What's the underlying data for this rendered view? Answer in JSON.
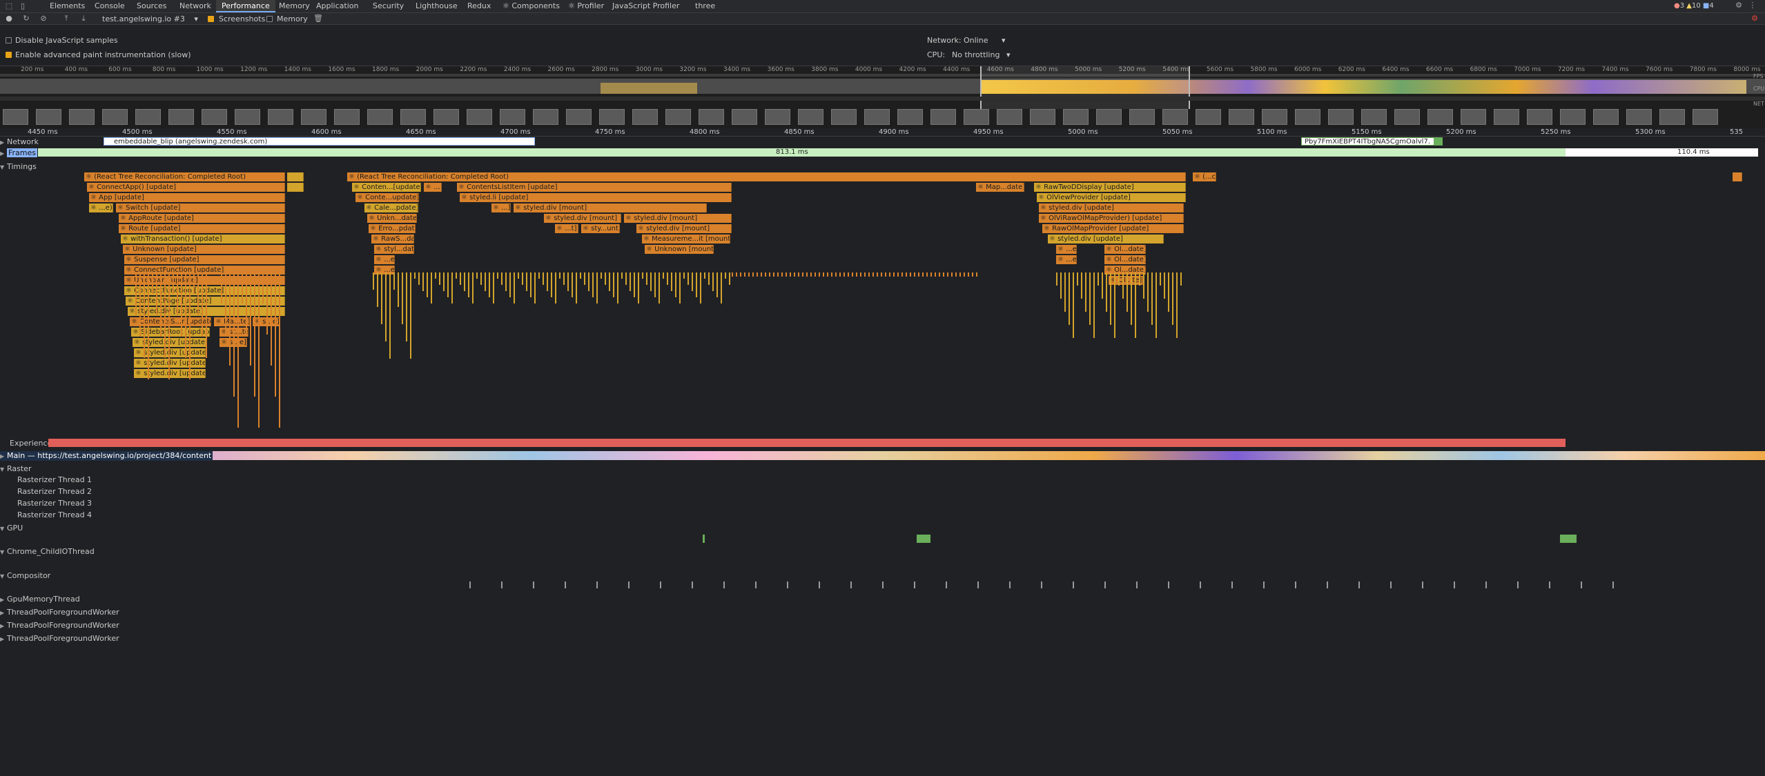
{
  "tabs": [
    "Elements",
    "Console",
    "Sources",
    "Network",
    "Performance",
    "Memory",
    "Application",
    "Security",
    "Lighthouse",
    "Redux",
    "Components",
    "Profiler",
    "JavaScript Profiler",
    "three"
  ],
  "active_tab": "Performance",
  "status": {
    "errors": "3",
    "warnings": "10",
    "info": "4"
  },
  "toolbar": {
    "profile_select": "test.angelswing.io #3",
    "screenshots": "Screenshots",
    "memory": "Memory"
  },
  "settings": {
    "disable_js": "Disable JavaScript samples",
    "advanced_paint": "Enable advanced paint instrumentation (slow)",
    "network_label": "Network:",
    "network_value": "Online",
    "cpu_label": "CPU:",
    "cpu_value": "No throttling"
  },
  "overview_ticks": [
    "200 ms",
    "400 ms",
    "600 ms",
    "800 ms",
    "1000 ms",
    "1200 ms",
    "1400 ms",
    "1600 ms",
    "1800 ms",
    "2000 ms",
    "2200 ms",
    "2400 ms",
    "2600 ms",
    "2800 ms",
    "3000 ms",
    "3200 ms",
    "3400 ms",
    "3600 ms",
    "3800 ms",
    "4000 ms",
    "4200 ms",
    "4400 ms",
    "4600 ms",
    "4800 ms",
    "5000 ms",
    "5200 ms",
    "5400 ms",
    "5600 ms",
    "5800 ms",
    "6000 ms",
    "6200 ms",
    "6400 ms",
    "6600 ms",
    "6800 ms",
    "7000 ms",
    "7200 ms",
    "7400 ms",
    "7600 ms",
    "7800 ms",
    "8000 ms"
  ],
  "overview_side": {
    "fps": "FPS",
    "cpu": "CPU",
    "net": "NET"
  },
  "ruler_ticks": [
    "4450 ms",
    "4500 ms",
    "4550 ms",
    "4600 ms",
    "4650 ms",
    "4700 ms",
    "4750 ms",
    "4800 ms",
    "4850 ms",
    "4900 ms",
    "4950 ms",
    "5000 ms",
    "5050 ms",
    "5100 ms",
    "5150 ms",
    "5200 ms",
    "5250 ms",
    "5300 ms",
    "535"
  ],
  "tracks": {
    "network": "Network",
    "network_req1": "embeddable_blip (angelswing.zendesk.com)",
    "network_req2": "Pby7FmXiEBPT4ITbgNA5CgmOalvl7.",
    "frames": "Frames",
    "frame1": "813.1 ms",
    "frame2": "110.4 ms",
    "timings": "Timings",
    "experience": "Experience",
    "main": "Main — https://test.angelswing.io/project/384/content",
    "raster": "Raster",
    "raster1": "Rasterizer Thread 1",
    "raster2": "Rasterizer Thread 2",
    "raster3": "Rasterizer Thread 3",
    "raster4": "Rasterizer Thread 4",
    "gpu": "GPU",
    "child_io": "Chrome_ChildIOThread",
    "compositor": "Compositor",
    "gpu_memory": "GpuMemoryThread",
    "pool1": "ThreadPoolForegroundWorker",
    "pool2": "ThreadPoolForegroundWorker",
    "pool3": "ThreadPoolForegroundWorker"
  },
  "flame": {
    "a1": "⚛ (React Tree Reconciliation: Completed Root)",
    "a2": "⚛ ConnectApp() [update]",
    "a3": "⚛ App [update]",
    "a4": "⚛ ...e)",
    "a5": "⚛ Switch [update]",
    "a6": "⚛ AppRoute [update]",
    "a7": "⚛ Route [update]",
    "a8": "⚛ withTransaction() [update]",
    "a9": "⚛ Unknown [update]",
    "a10": "⚛ Suspense [update]",
    "a11": "⚛ ConnectFunction [update]",
    "a12": "⚛ Unknown [update]",
    "a13": "⚛ ConnectFunction [update]",
    "a14": "⚛ ContentPage [update]",
    "a15": "⚛ styled.div [update]",
    "a16": "⚛ ContentsS...r [update]",
    "a17": "⚛ Ma...te]",
    "a18": "⚛ s...e]",
    "a19": "⚛ SidebarRoot [update]",
    "a20": "⚛ st...te]",
    "a21": "⚛ styled.div [update]",
    "a22": "⚛ s...e]",
    "a23": "⚛ styled.div [update]",
    "a24": "⚛ styled.div [update]",
    "a25": "⚛ styled.div [update]",
    "b1": "⚛ (React Tree Reconciliation: Completed Root)",
    "b2": "⚛ Conten...[update]",
    "b3": "⚛ ...",
    "b4": "⚛ ContentsListItem [update]",
    "b5": "⚛ Conte...update]",
    "b6": "⚛ styled.li [update]",
    "b7": "⚛ Cale...pdate]",
    "b8": "⚛ ...]",
    "b9": "⚛ styled.div [mount]",
    "b10": "⚛ Unkn...date]",
    "b11": "⚛ styled.div [mount]",
    "b12": "⚛ styled.div [mount]",
    "b13": "⚛ Erro...pdate]",
    "b14": "⚛ ...t]",
    "b15": "⚛ sty...unt]",
    "b16": "⚛ styled.div [mount]",
    "b17": "⚛ RawS...date]",
    "b18": "⚛ Measureme...it [mount]",
    "b19": "⚛ styl...date]",
    "b20": "⚛ Unknown [mount]",
    "b21": "⚛ ...e]",
    "b22": "⚛ ...e]",
    "c1": "⚛ Map...date]",
    "c2": "⚛ RawTwoDDisplay [update]",
    "c3": "⚛ (...c)",
    "c4": "⚛ OlViewProvider [update]",
    "c5": "⚛ styled.div [update]",
    "c6": "⚛ OlViRawOlMapProvider) [update]",
    "c7": "⚛ RawOlMapProvider [update]",
    "c8": "⚛ styled.div [update]",
    "c9": "⚛ ...e]",
    "c10": "⚛ Ol...date]",
    "c11": "⚛ ...e]",
    "c12": "⚛ Ol...date]",
    "c13": "⚛ Ol...date]",
    "c14": "⚛ Ol...te]"
  },
  "colors": {
    "background": "#202124",
    "tabbar": "#292a2d",
    "accent": "#7cacf8",
    "react_orange": "#d9822b",
    "react_yellow": "#d4a52c",
    "experience": "#e05f5a",
    "frames": "#c8f0c0",
    "gpu": "#6aaf5a"
  }
}
